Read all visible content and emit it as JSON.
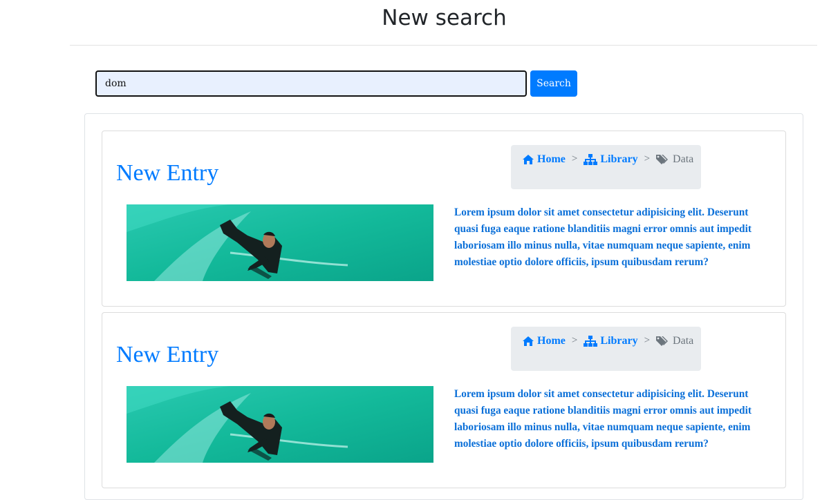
{
  "page": {
    "title": "New search"
  },
  "search": {
    "value": "dom",
    "button_label": "Search"
  },
  "colors": {
    "accent": "#007bff",
    "breadcrumb_bg": "#e9ecef",
    "muted": "#6c757d"
  },
  "entries": [
    {
      "title": "New Entry",
      "breadcrumb": [
        {
          "label": "Home",
          "icon": "home-icon"
        },
        {
          "label": "Library",
          "icon": "sitemap-icon"
        },
        {
          "label": "Data",
          "icon": "tags-icon"
        }
      ],
      "separator": ">",
      "image": "surfer-photo",
      "text": "Lorem ipsum dolor sit amet consectetur adipisicing elit. Deserunt quasi fuga eaque ratione blanditiis magni error omnis aut impedit laboriosam illo minus nulla, vitae numquam neque sapiente, enim molestiae optio dolore officiis, ipsum quibusdam rerum?"
    },
    {
      "title": "New Entry",
      "breadcrumb": [
        {
          "label": "Home",
          "icon": "home-icon"
        },
        {
          "label": "Library",
          "icon": "sitemap-icon"
        },
        {
          "label": "Data",
          "icon": "tags-icon"
        }
      ],
      "separator": ">",
      "image": "surfer-photo",
      "text": "Lorem ipsum dolor sit amet consectetur adipisicing elit. Deserunt quasi fuga eaque ratione blanditiis magni error omnis aut impedit laboriosam illo minus nulla, vitae numquam neque sapiente, enim molestiae optio dolore officiis, ipsum quibusdam rerum?"
    }
  ]
}
